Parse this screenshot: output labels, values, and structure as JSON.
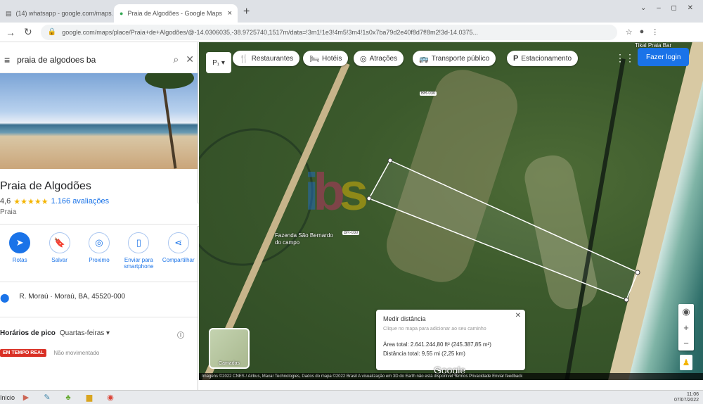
{
  "browser": {
    "tabs": [
      {
        "label": "(14) whatsapp - google.com/maps..."
      },
      {
        "label": "Praia de Algodões - Google Maps"
      }
    ],
    "new_tab_symbol": "+",
    "url": "google.com/maps/place/Praia+de+Algodões/@-14.0306035,-38.9725740,1517m/data=!3m1!1e3!4m5!3m4!1s0x7ba79d2e40f8d7f!8m2!3d-14.0375...",
    "window_controls": "⌄ – ◻ ✕"
  },
  "panel": {
    "search_value": "praia de algodoes ba",
    "place_title": "Praia de Algodões",
    "rating_value": "4,6",
    "stars": "★★★★★",
    "reviews": "1.166 avaliações",
    "category": "Praia",
    "actions": [
      {
        "label": "Rotas",
        "icon": "directions-icon",
        "glyph": "➤"
      },
      {
        "label": "Salvar",
        "icon": "bookmark-icon",
        "glyph": "🔖"
      },
      {
        "label": "Proximo",
        "icon": "nearby-icon",
        "glyph": "◎"
      },
      {
        "label": "Enviar para smartphone",
        "icon": "phone-icon",
        "glyph": "▯"
      },
      {
        "label": "Compartilhar",
        "icon": "share-icon",
        "glyph": "⋖"
      }
    ],
    "address": "R. Moraú · Moraú, BA, 45520-000",
    "hours_title": "Horários de pico",
    "hours_day": "Quartas-feiras ▾",
    "live_badge": "EM TEMPO REAL",
    "live_text": "Não movimentado"
  },
  "map": {
    "chips": [
      {
        "label": "Restaurantes",
        "icon": "restaurant-icon",
        "glyph": "🍴"
      },
      {
        "label": "Hotéis",
        "icon": "hotel-icon",
        "glyph": "🛏"
      },
      {
        "label": "Atrações",
        "icon": "attractions-icon",
        "glyph": "◎"
      },
      {
        "label": "Transporte público",
        "icon": "transit-icon",
        "glyph": "🚌"
      },
      {
        "label": "Estacionamento",
        "icon": "parking-icon",
        "glyph": "P"
      }
    ],
    "login_label": "Fazer login",
    "poi_top": "Tikal Praia Bar",
    "poi_fazenda": "Fazenda São Bernardo do campo",
    "highway": "BR-030",
    "measure": {
      "title": "Medir distância",
      "hint": "Clique no mapa para adicionar ao seu caminho",
      "area": "Área total: 2.641.244,80 ft² (245.387,85 m²)",
      "distance": "Distância total: 9,55 mi (2,25 km)"
    },
    "layer_label": "Camadas",
    "google_logo": "Google",
    "footer": "Imagens ©2022 CNES / Airbus, Maxar Technologies, Dados do mapa ©2022   Brasil   A visualização em 3D do Earth não está disponível   Termos   Privacidade   Enviar feedback"
  },
  "taskbar": {
    "start_label": "Inicio",
    "clock_time": "11:06",
    "clock_date": "07/07/2022"
  },
  "watermark": "ibs",
  "colors": {
    "accent": "#1a73e8",
    "live": "#d93025",
    "star": "#f4b400"
  }
}
